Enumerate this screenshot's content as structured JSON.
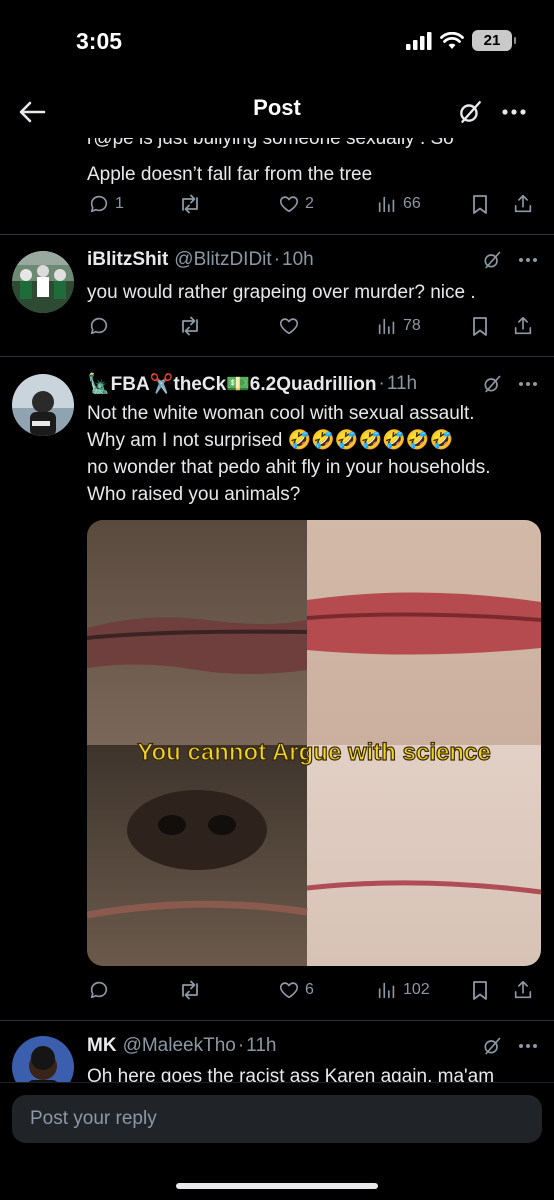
{
  "status": {
    "time": "3:05",
    "battery": "21"
  },
  "header": {
    "title": "Post"
  },
  "tweets": [
    {
      "text_line1": "r@pe is just bullying someone sexually . So",
      "text_line2": "Apple doesn’t fall far from the tree",
      "replies": "1",
      "likes": "2",
      "views": "66"
    },
    {
      "name": "iBlitzShit",
      "handle": "@BlitzDIDit",
      "separator": "·",
      "time": "10h",
      "text": "you would rather grapeing over murder? nice .",
      "views": "78"
    },
    {
      "name": "🗽FBA✂️theCk💵6.2Quadrillion",
      "separator": "·",
      "time": "11h",
      "text_line1": "Not the white woman cool with sexual assault.",
      "text_line2": "Why am I not surprised 🤣🤣🤣🤣🤣🤣🤣",
      "text_line3": "no wonder that pedo ahit fly in your households.",
      "text_line4": "Who raised you animals?",
      "image_caption": "You cannot Argue with science",
      "likes": "6",
      "views": "102"
    },
    {
      "name": "MK",
      "handle": "@MaleekTho",
      "separator": "·",
      "time": "11h",
      "text": "Oh here goes the racist ass Karen again. ma'am"
    }
  ],
  "reply": {
    "placeholder": "Post your reply"
  },
  "icons": {
    "back": "arrow-left-icon",
    "grok": "grok-icon",
    "more": "more-dots-icon",
    "reply": "comment-icon",
    "repost": "repost-icon",
    "like": "heart-icon",
    "views": "views-icon",
    "bookmark": "bookmark-icon",
    "share": "share-icon"
  },
  "colors": {
    "background": "#000000",
    "text": "#e7e9ea",
    "muted": "#8b98a5",
    "divider": "#2f3336"
  }
}
